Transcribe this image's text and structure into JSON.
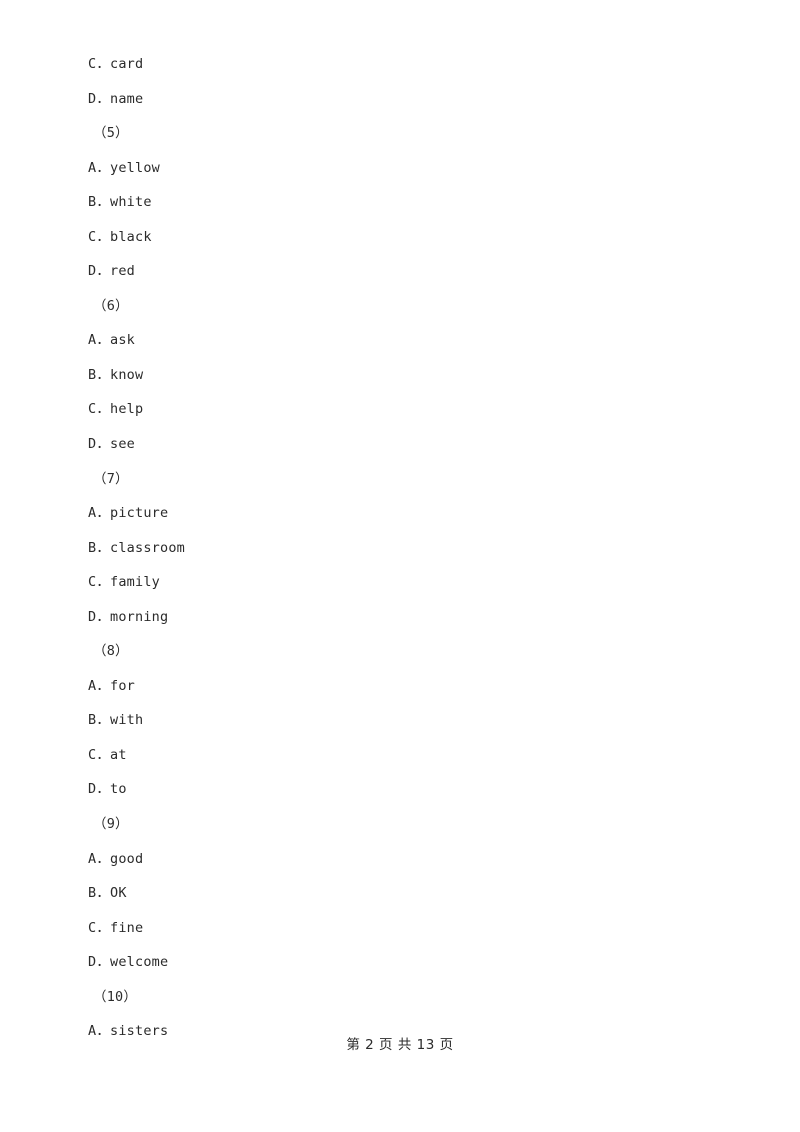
{
  "document": {
    "page_background": "#ffffff",
    "text_color": "#2b2b2b"
  },
  "body_lines": [
    {
      "type": "option",
      "text": "C．card"
    },
    {
      "type": "option",
      "text": "D．name"
    },
    {
      "type": "qnum",
      "text": "（5）"
    },
    {
      "type": "option",
      "text": "A．yellow"
    },
    {
      "type": "option",
      "text": "B．white"
    },
    {
      "type": "option",
      "text": "C．black"
    },
    {
      "type": "option",
      "text": "D．red"
    },
    {
      "type": "qnum",
      "text": "（6）"
    },
    {
      "type": "option",
      "text": "A．ask"
    },
    {
      "type": "option",
      "text": "B．know"
    },
    {
      "type": "option",
      "text": "C．help"
    },
    {
      "type": "option",
      "text": "D．see"
    },
    {
      "type": "qnum",
      "text": "（7）"
    },
    {
      "type": "option",
      "text": "A．picture"
    },
    {
      "type": "option",
      "text": "B．classroom"
    },
    {
      "type": "option",
      "text": "C．family"
    },
    {
      "type": "option",
      "text": "D．morning"
    },
    {
      "type": "qnum",
      "text": "（8）"
    },
    {
      "type": "option",
      "text": "A．for"
    },
    {
      "type": "option",
      "text": "B．with"
    },
    {
      "type": "option",
      "text": "C．at"
    },
    {
      "type": "option",
      "text": "D．to"
    },
    {
      "type": "qnum",
      "text": "（9）"
    },
    {
      "type": "option",
      "text": "A．good"
    },
    {
      "type": "option",
      "text": "B．OK"
    },
    {
      "type": "option",
      "text": "C．fine"
    },
    {
      "type": "option",
      "text": "D．welcome"
    },
    {
      "type": "qnum",
      "text": "（10）"
    },
    {
      "type": "option",
      "text": "A．sisters"
    }
  ],
  "footer": {
    "text": "第 2 页 共 13 页",
    "current_page": "2",
    "total_pages": "13"
  }
}
